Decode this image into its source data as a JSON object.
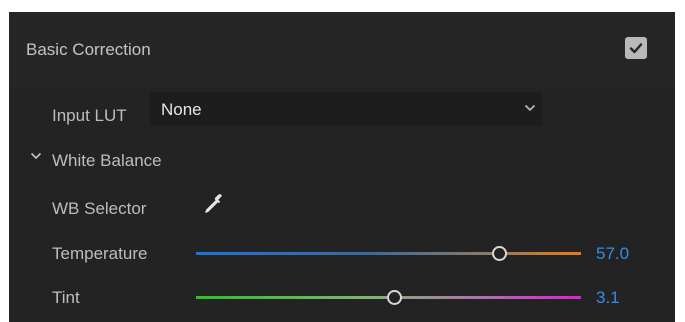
{
  "section": {
    "title": "Basic Correction",
    "enabled": true
  },
  "input_lut": {
    "label": "Input LUT",
    "value": "None"
  },
  "white_balance": {
    "title": "White Balance",
    "selector_label": "WB Selector",
    "temperature": {
      "label": "Temperature",
      "value": "57.0"
    },
    "tint": {
      "label": "Tint",
      "value": "3.1"
    }
  },
  "colors": {
    "accent_value": "#2f8fea",
    "panel_bg": "#232323"
  }
}
